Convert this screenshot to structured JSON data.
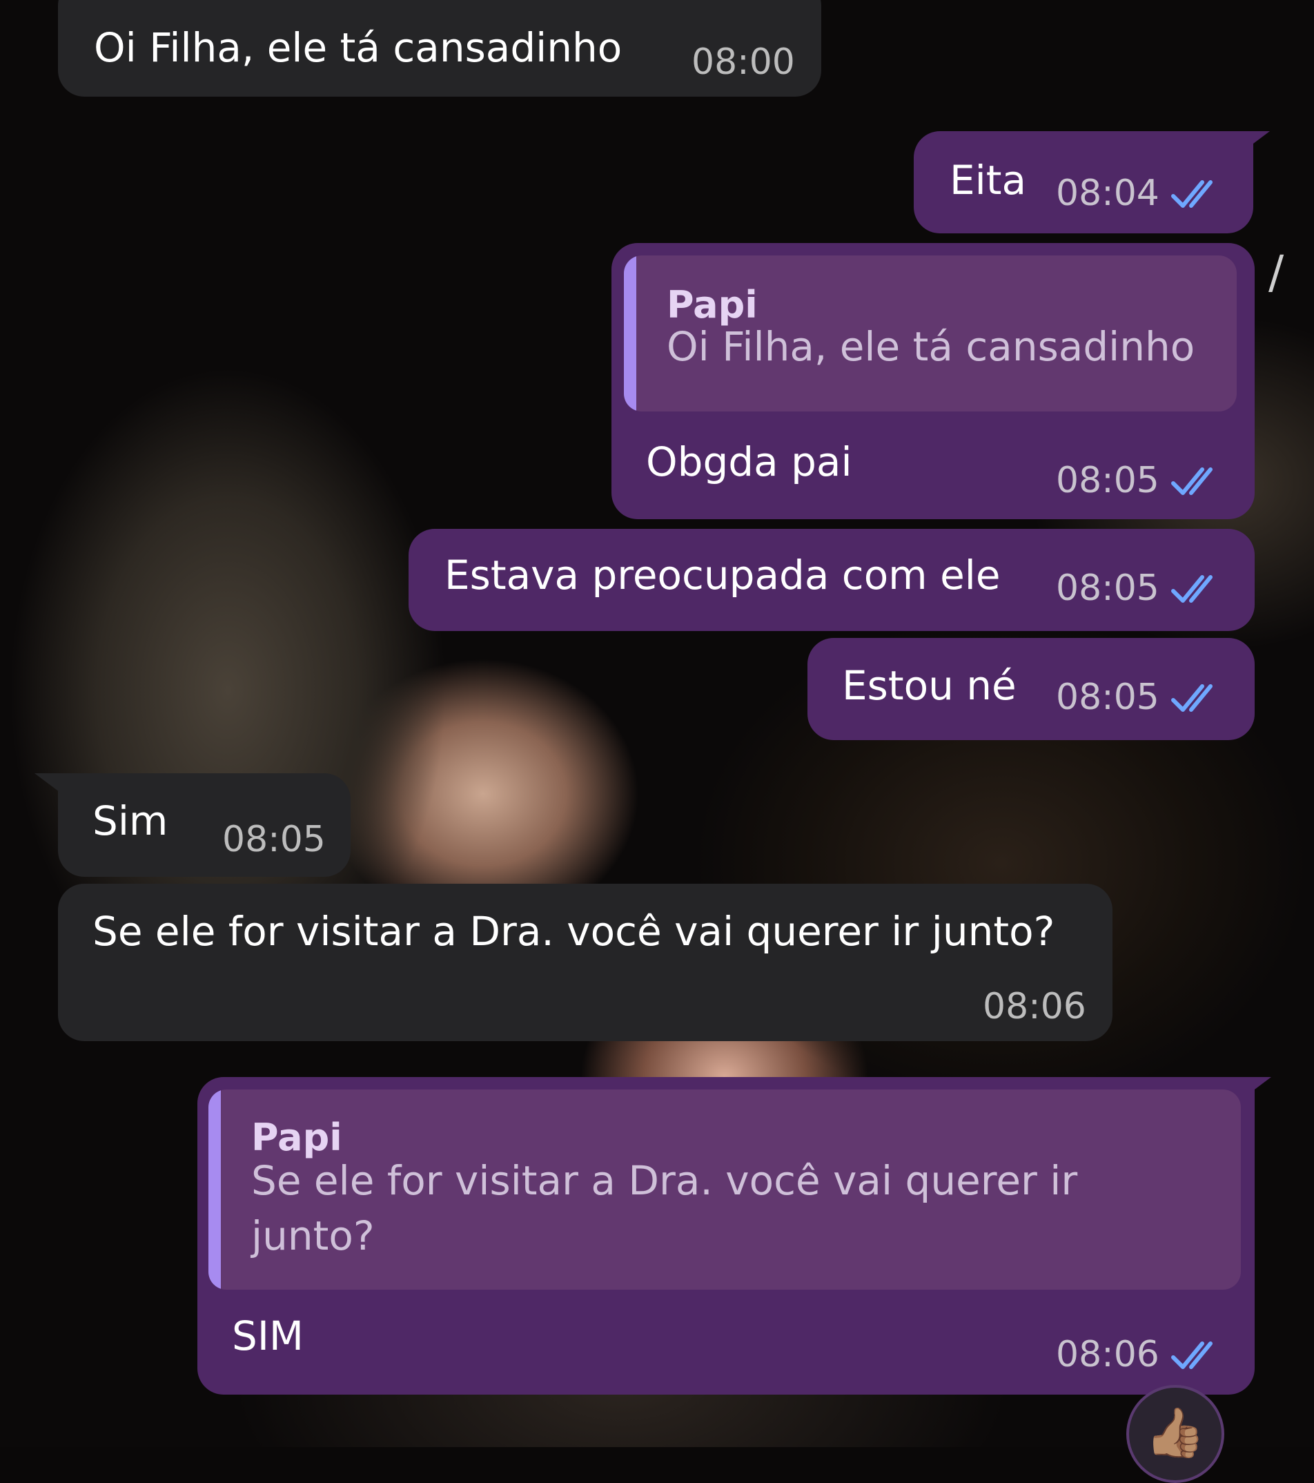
{
  "messages": [
    {
      "id": "m1",
      "text": "Oi Filha, ele tá cansadinho",
      "time": "08:00"
    },
    {
      "id": "m2",
      "text": "Eita",
      "time": "08:04"
    },
    {
      "id": "m3",
      "reply_author": "Papi",
      "reply_text": "Oi Filha, ele tá cansadinho",
      "text": "Obgda pai",
      "time": "08:05"
    },
    {
      "id": "m4",
      "text": "Estava preocupada com ele",
      "time": "08:05"
    },
    {
      "id": "m5",
      "text": "Estou né",
      "time": "08:05"
    },
    {
      "id": "m6",
      "text": "Sim",
      "time": "08:05"
    },
    {
      "id": "m7",
      "text": "Se ele for visitar a Dra. você vai querer ir junto?",
      "time": "08:06"
    },
    {
      "id": "m8",
      "reply_author": "Papi",
      "reply_text": "Se ele for visitar a Dra. você vai querer ir junto?",
      "text": "SIM",
      "time": "08:06"
    }
  ],
  "reaction_emoji": "👍🏽",
  "side_glyph": "/",
  "colors": {
    "incoming_bubble": "#252527",
    "outgoing_bubble": "#4f2866",
    "reply_block": "#62386f",
    "reply_accent": "#a78bf0",
    "read_ticks": "#6fa8ff"
  }
}
